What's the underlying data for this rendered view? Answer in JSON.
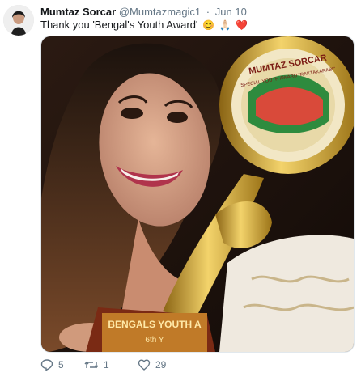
{
  "tweet": {
    "author_name": "Mumtaz Sorcar",
    "handle": "@Mumtazmagic1",
    "separator": "·",
    "date": "Jun 10",
    "text": "Thank you 'Bengal's Youth Award'",
    "emojis": [
      "😊",
      "🙏🏻",
      "❤️"
    ],
    "avatar_icon": "profile-photo",
    "media": {
      "description_icon": "photo-with-trophy",
      "trophy_plate_text": [
        "MUMTAZ SORCAR",
        "SPECIAL YOUTH AWARD \"RAKTAKARABI\""
      ],
      "trophy_base_text": [
        "BENGALS YOUTH A",
        "6th Y"
      ]
    },
    "actions": {
      "reply_count": "5",
      "retweet_count": "1",
      "like_count": "29"
    },
    "colors": {
      "text": "#14171a",
      "muted": "#657786",
      "gold": "#c9a227",
      "like": "#e0245e"
    }
  }
}
